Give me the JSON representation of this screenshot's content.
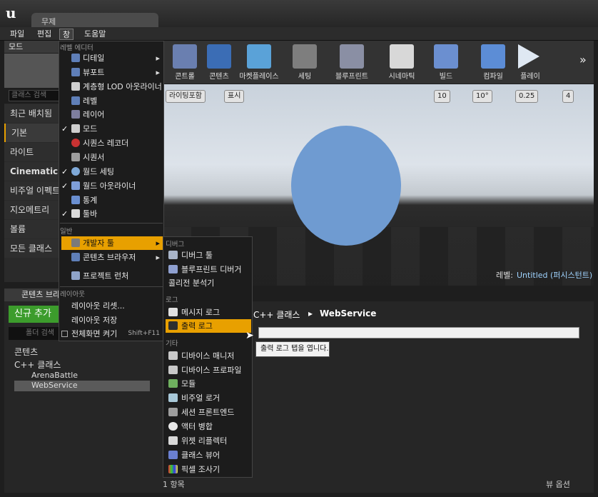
{
  "window": {
    "tab_title": "무제"
  },
  "menubar": [
    "파일",
    "편집",
    "창",
    "도움말"
  ],
  "modes_panel": {
    "header": "모드",
    "search_placeholder": "클래스 검색",
    "categories": [
      "최근 배치됨",
      "기본",
      "라이트",
      "Cinematic",
      "비주얼 이펙트",
      "지오메트리",
      "볼륨",
      "모든 클래스"
    ]
  },
  "toolbar": {
    "buttons": [
      "콘트롤",
      "콘텐츠",
      "마켓플레이스",
      "세팅",
      "블루프린트",
      "시네마틱",
      "빌드",
      "컴파일",
      "플레이"
    ]
  },
  "viewport": {
    "lit_label": "라이팅포함",
    "show_label": "표시",
    "grid_snap": "10",
    "rot_snap": "10°",
    "scale_snap": "0.25",
    "cam_speed": "4",
    "level_label": "레벨:",
    "level_value": "Untitled (퍼시스턴트)"
  },
  "content_browser": {
    "tab_label": "콘텐츠 브라",
    "add_new": "신규 추가",
    "filter": "필터",
    "search_placeholder": "폴더 검색",
    "tree": [
      "콘텐츠",
      "C++ 클래스",
      "ArenaBattle",
      "WebService"
    ],
    "path": [
      "C++ 클래스",
      "WebService"
    ],
    "item_count": "1 항목",
    "view_options": "뷰 옵션"
  },
  "window_menu": {
    "section_level_editor": "레벨 에디터",
    "level_items": [
      {
        "label": "디테일",
        "checked": false,
        "submenu": true
      },
      {
        "label": "뷰포트",
        "checked": false,
        "submenu": true
      },
      {
        "label": "계층형 LOD 아웃라이너",
        "checked": false,
        "submenu": false
      },
      {
        "label": "레벨",
        "checked": false,
        "submenu": false
      },
      {
        "label": "레이어",
        "checked": false,
        "submenu": false
      },
      {
        "label": "모드",
        "checked": true,
        "submenu": false
      },
      {
        "label": "시퀀스 레코더",
        "checked": false,
        "submenu": false
      },
      {
        "label": "시퀀서",
        "checked": false,
        "submenu": false
      },
      {
        "label": "월드 세팅",
        "checked": true,
        "submenu": false
      },
      {
        "label": "월드 아웃라이너",
        "checked": true,
        "submenu": false
      },
      {
        "label": "통계",
        "checked": false,
        "submenu": false
      },
      {
        "label": "툴바",
        "checked": true,
        "submenu": false
      }
    ],
    "section_general": "일반",
    "general_items": [
      {
        "label": "개발자 툴",
        "submenu": true,
        "highlighted": true
      },
      {
        "label": "콘텐츠 브라우저",
        "submenu": true,
        "highlighted": false
      },
      {
        "label": "프로젝트 런처",
        "submenu": false,
        "highlighted": false
      }
    ],
    "section_layout": "레이아웃",
    "layout_items": [
      {
        "label": "레이아웃 리셋..."
      },
      {
        "label": "레이아웃 저장"
      },
      {
        "label": "전체화면 켜기",
        "shortcut": "Shift+F11"
      }
    ]
  },
  "dev_tools_submenu": {
    "section_debug": "디버그",
    "debug_items": [
      "디버그 툴",
      "블루프린트 디버거",
      "콜리전 분석기"
    ],
    "section_log": "로그",
    "log_items": [
      "메시지 로그",
      "출력 로그"
    ],
    "highlighted": "출력 로그",
    "section_misc": "기타",
    "misc_items": [
      "디바이스 매니저",
      "디바이스 프로파일",
      "모듈",
      "비주얼 로거",
      "세션 프론트엔드",
      "액터 병합",
      "위젯 리플렉터",
      "클래스 뷰어",
      "픽셀 조사기"
    ]
  },
  "tooltip": "출력 로그 탭을 엽니다."
}
